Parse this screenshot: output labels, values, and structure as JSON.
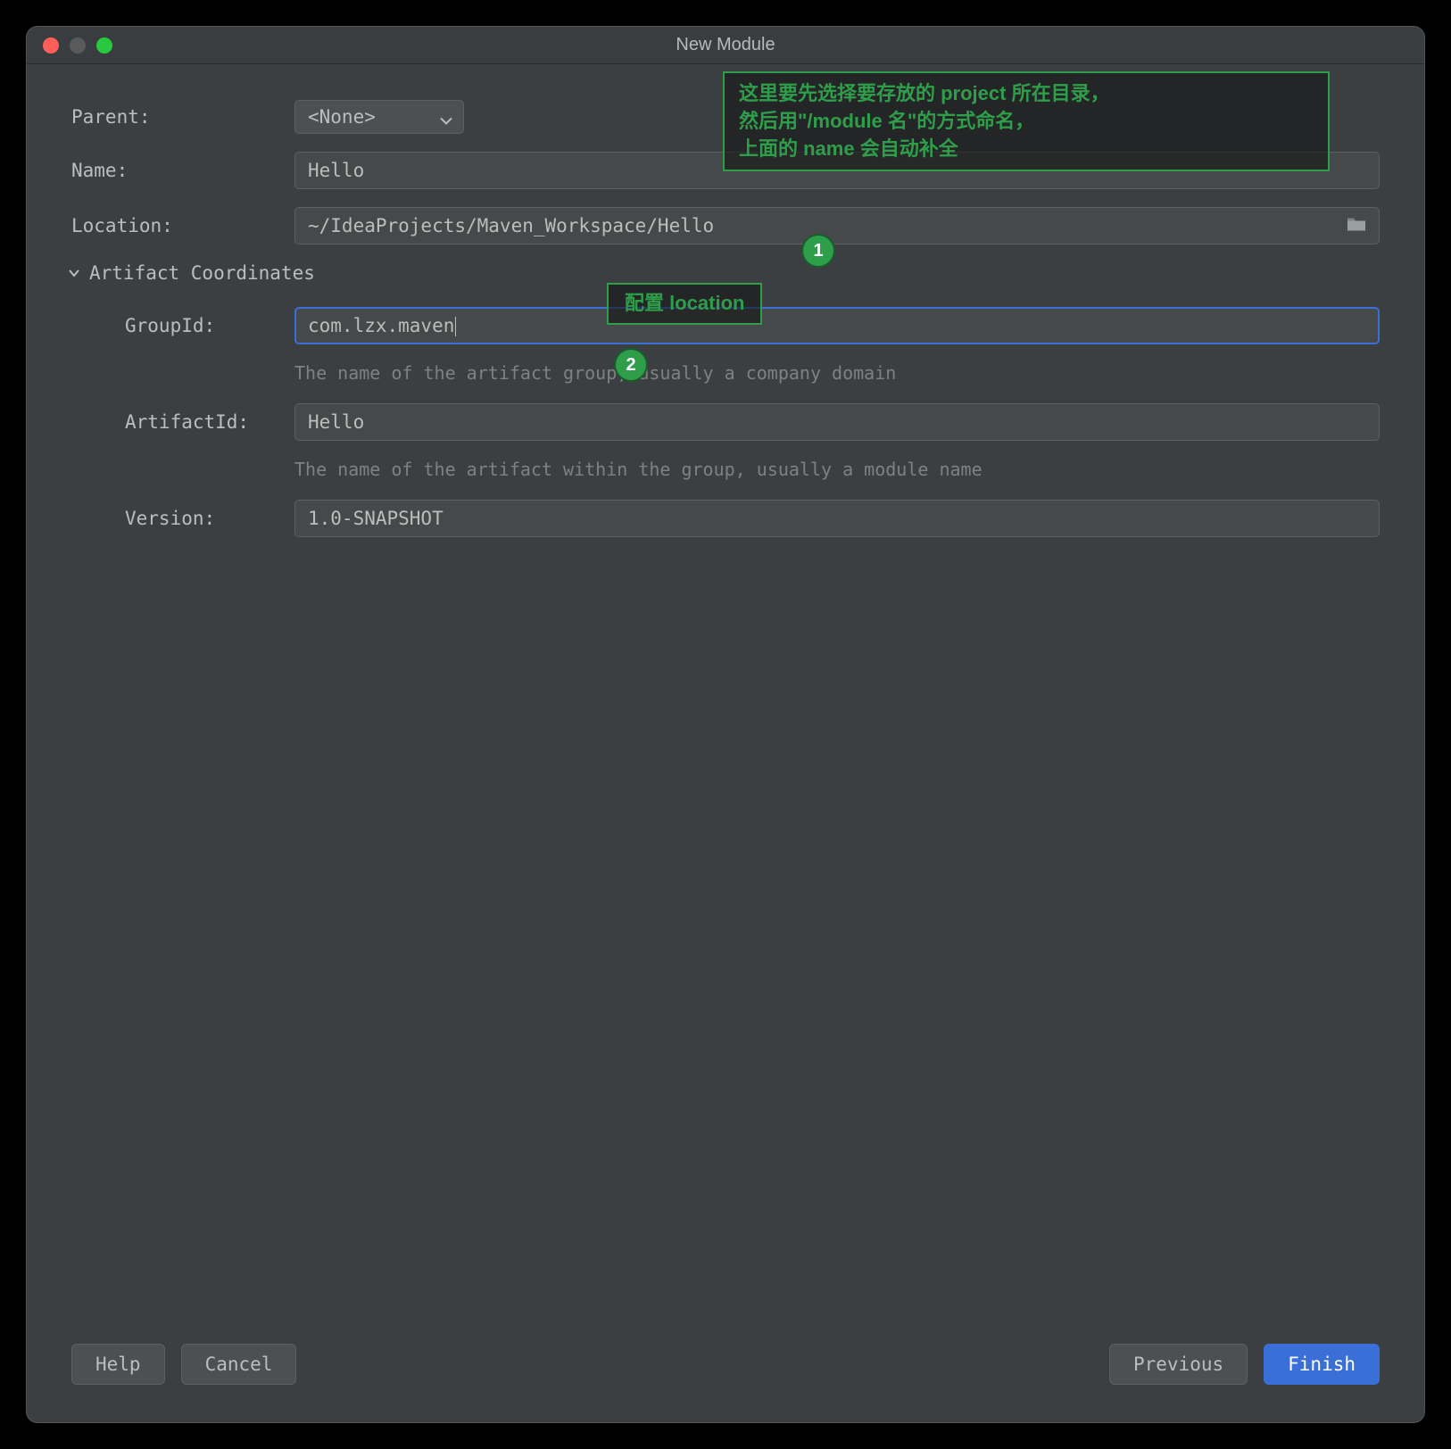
{
  "window": {
    "title": "New Module"
  },
  "form": {
    "parent_label": "Parent:",
    "parent_value": "<None>",
    "name_label": "Name:",
    "name_value": "Hello",
    "location_label": "Location:",
    "location_value": "~/IdeaProjects/Maven_Workspace/Hello",
    "artifact_section": "Artifact Coordinates",
    "groupid_label": "GroupId:",
    "groupid_value": "com.lzx.maven",
    "groupid_hint": "The name of the artifact group, usually a company domain",
    "artifactid_label": "ArtifactId:",
    "artifactid_value": "Hello",
    "artifactid_hint": "The name of the artifact within the group, usually a module name",
    "version_label": "Version:",
    "version_value": "1.0-SNAPSHOT"
  },
  "buttons": {
    "help": "Help",
    "cancel": "Cancel",
    "previous": "Previous",
    "finish": "Finish"
  },
  "annotations": {
    "a1_line1": "这里要先选择要存放的 project 所在目录，",
    "a1_line2": "然后用\"/module 名\"的方式命名，",
    "a1_line3": "上面的 name 会自动补全",
    "a2": "配置 location",
    "step1": "1",
    "step2": "2"
  }
}
